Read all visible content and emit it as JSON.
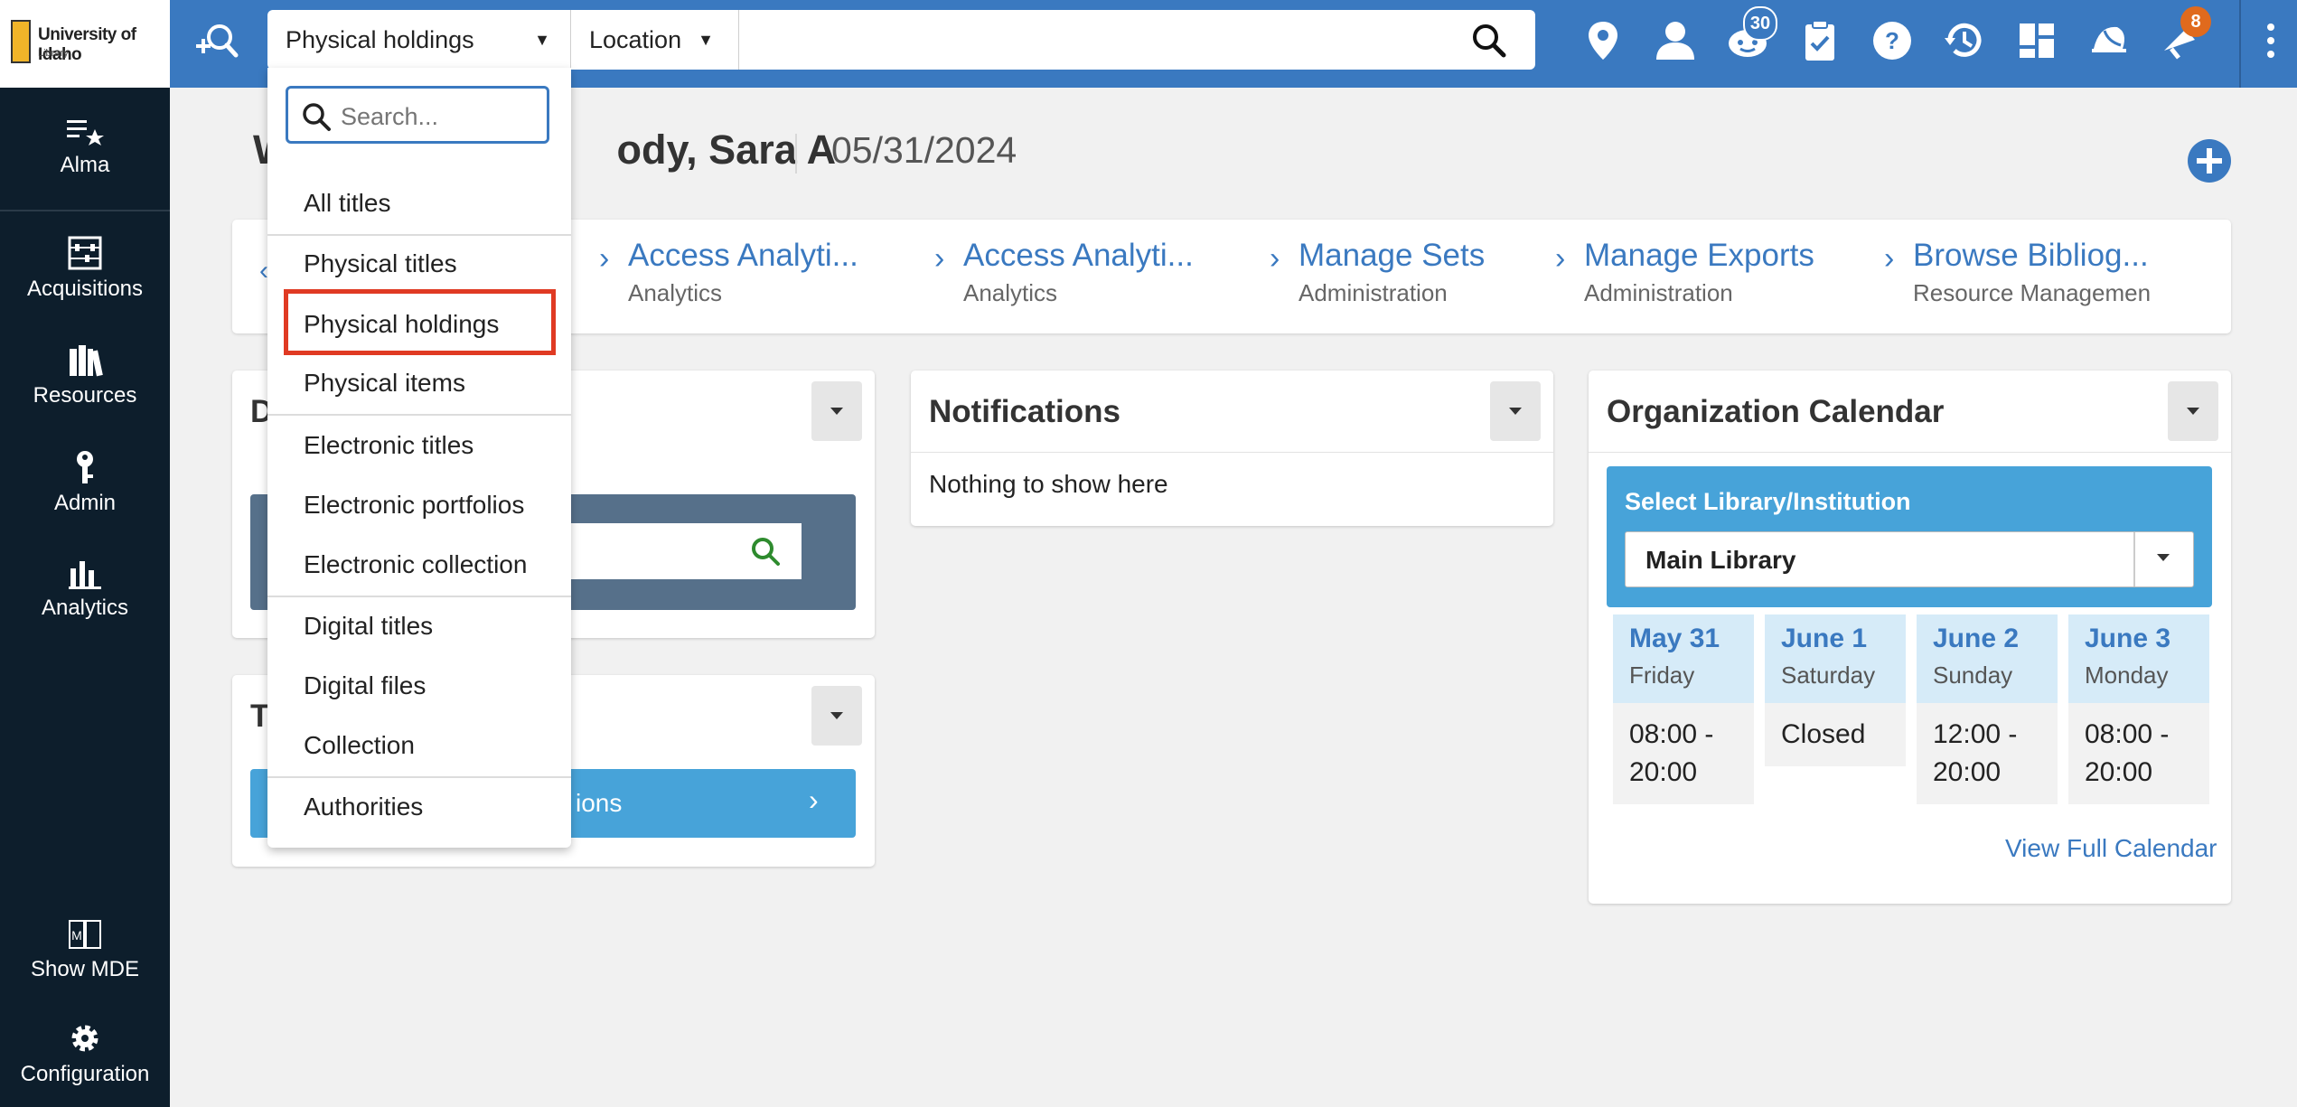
{
  "logo": {
    "name": "University of Idaho",
    "sub": "Library"
  },
  "search": {
    "scope_selected": "Physical holdings",
    "location_selected": "Location",
    "placeholder": "Search..."
  },
  "topbar_badges": {
    "tasks_count": "30",
    "notifications_count": "8"
  },
  "topbar_icons": [
    "persistent-search-icon",
    "location-pin-icon",
    "user-icon",
    "tasks-icon",
    "clipboard-icon",
    "help-icon",
    "history-icon",
    "layout-icon",
    "announcements-icon",
    "notifications-icon",
    "more-icon"
  ],
  "sidebar": {
    "items": [
      {
        "label": "Alma",
        "icon": "alma-icon"
      },
      {
        "label": "Acquisitions",
        "icon": "abacus-icon"
      },
      {
        "label": "Resources",
        "icon": "books-icon"
      },
      {
        "label": "Admin",
        "icon": "key-icon"
      },
      {
        "label": "Analytics",
        "icon": "bar-chart-icon"
      }
    ],
    "bottom_items": [
      {
        "label": "Show MDE",
        "icon": "mde-icon"
      },
      {
        "label": "Configuration",
        "icon": "gear-icon"
      }
    ]
  },
  "page": {
    "title_start": "W",
    "title_end": "ody, Sara A",
    "date": "05/31/2024"
  },
  "recent_pages": [
    {
      "title": "Access Analyti...",
      "sub": "Analytics"
    },
    {
      "title": "Access Analyti...",
      "sub": "Analytics"
    },
    {
      "title": "Manage Sets",
      "sub": "Administration"
    },
    {
      "title": "Manage Exports",
      "sub": "Administration"
    },
    {
      "title": "Browse Bibliog...",
      "sub": "Resource Managemen"
    }
  ],
  "dropdown": {
    "items": [
      "All titles",
      "Physical titles",
      "Physical holdings",
      "Physical items",
      "Electronic titles",
      "Electronic portfolios",
      "Electronic collection",
      "Digital titles",
      "Digital files",
      "Collection",
      "Authorities"
    ]
  },
  "widgets": {
    "left1_title_fragment": "D",
    "left2_title_fragment": "T",
    "left2_button_fragment": "ions",
    "notifications": {
      "title": "Notifications",
      "empty_text": "Nothing to show here"
    },
    "calendar": {
      "title": "Organization Calendar",
      "select_label": "Select Library/Institution",
      "selected_library": "Main Library",
      "days": [
        {
          "date": "May  31",
          "weekday": "Friday",
          "hours": "08:00 - 20:00"
        },
        {
          "date": "June  1",
          "weekday": "Saturday",
          "hours": "Closed"
        },
        {
          "date": "June  2",
          "weekday": "Sunday",
          "hours": "12:00 - 20:00"
        },
        {
          "date": "June  3",
          "weekday": "Monday",
          "hours": "08:00 - 20:00"
        }
      ],
      "view_full": "View Full Calendar"
    }
  },
  "colors": {
    "topbar": "#3a79c0",
    "sidebar": "#0d1e2c",
    "highlight": "#e03a23",
    "badge_orange": "#e06a1d"
  }
}
